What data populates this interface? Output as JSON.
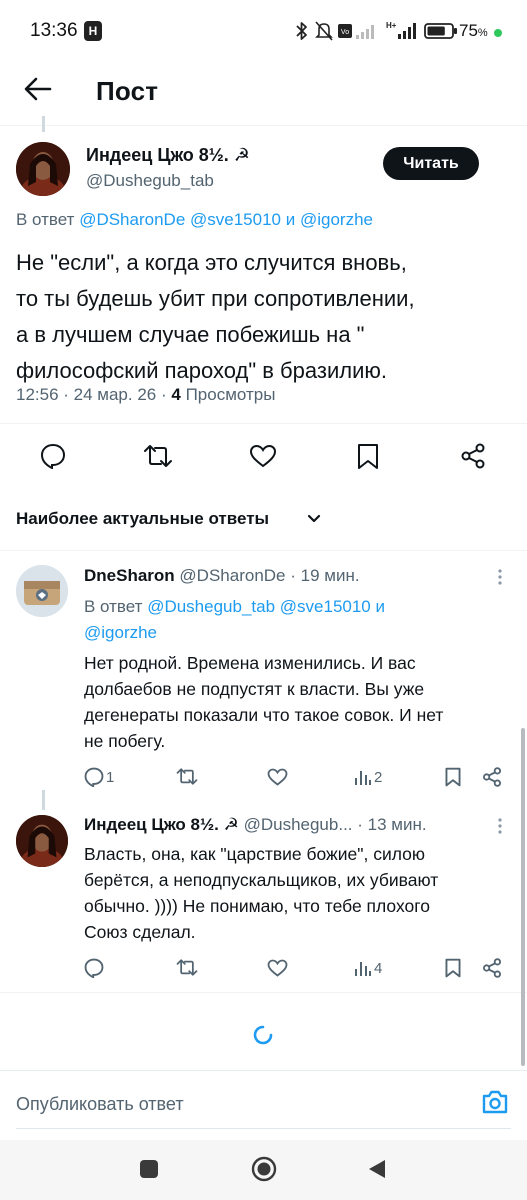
{
  "status_bar": {
    "time": "13:36",
    "app_badge": "H",
    "battery_percent": "75",
    "battery_level": 0.75
  },
  "header": {
    "title": "Пост"
  },
  "main_post": {
    "author_name": "Индеец Цжо 8½. ☭",
    "author_handle": "@Dushegub_tab",
    "follow_label": "Читать",
    "reply_prefix": "В ответ",
    "reply_handle_1": "@DSharonDe",
    "reply_handle_2": "@sve15010",
    "reply_conj": "и",
    "reply_handle_3": "@igorzhe",
    "text_lines": [
      "Не \"если\", а когда это случится вновь,",
      "то ты будешь убит при сопротивлении,",
      "а в лучшем случае побежишь на \"",
      "философский пароход\" в бразилию."
    ],
    "timestamp": "12:56 · 24 мар. 26 ·",
    "views_count": "4",
    "views_label": "Просмотры"
  },
  "sort": {
    "label": "Наиболее актуальные ответы"
  },
  "replies": [
    {
      "author_name": "DneSharon",
      "author_handle": "@DSharonDe",
      "time": "· 19 мин.",
      "reply_prefix": "В ответ",
      "reply_handle_1": "@Dushegub_tab",
      "reply_handle_2": "@sve15010",
      "reply_conj": "и",
      "reply_handle_3": "@igorzhe",
      "text_lines": [
        "Нет родной. Времена изменились. И вас",
        "долбаебов не подпустят к власти. Вы уже",
        "дегенераты показали что такое совок. И нет",
        "не побегу."
      ],
      "reply_count": "1",
      "views_count": "2"
    },
    {
      "author_name": "Индеец Цжо 8½. ☭",
      "author_handle": "@Dushegub...",
      "time": "· 13 мин.",
      "text_lines": [
        "Власть, она, как \"царствие божие\", силою",
        "берётся, а неподпускальщиков, их убивают",
        "обычно. )))) Не понимаю, что тебе плохого",
        "Союз сделал."
      ],
      "views_count": "4"
    }
  ],
  "composer": {
    "placeholder": "Опубликовать ответ"
  },
  "colors": {
    "accent": "#1d9bf0",
    "text": "#0f1419",
    "muted": "#536471",
    "divider": "#eff3f4",
    "battery_ok": "#2ec95c"
  },
  "icons": [
    "back-arrow-icon",
    "reply-icon",
    "retweet-icon",
    "like-icon",
    "bookmark-icon",
    "share-icon",
    "views-icon",
    "more-icon",
    "chevron-down-icon",
    "camera-icon",
    "loading-spinner-icon",
    "bluetooth-icon",
    "mute-icon",
    "signal-icon",
    "battery-icon",
    "nav-square-icon",
    "nav-home-icon",
    "nav-back-icon"
  ]
}
